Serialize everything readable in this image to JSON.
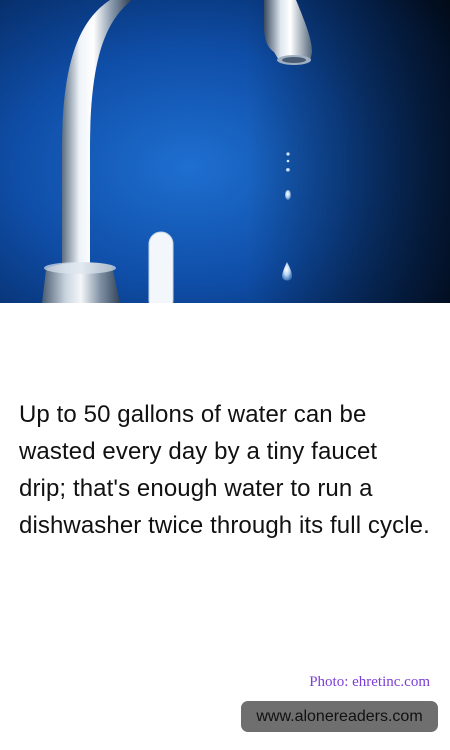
{
  "photo": {
    "icon": "faucet-dripping-photo"
  },
  "fact": {
    "text": "Up to 50 gallons of water can be wasted every day by a tiny faucet drip; that's enough water to run a dishwasher twice through its full cycle."
  },
  "credit": {
    "text": "Photo: ehretinc.com",
    "color": "#7b3fd6"
  },
  "site": {
    "url": "www.alonereaders.com",
    "badge_color": "#6f6f6f"
  }
}
